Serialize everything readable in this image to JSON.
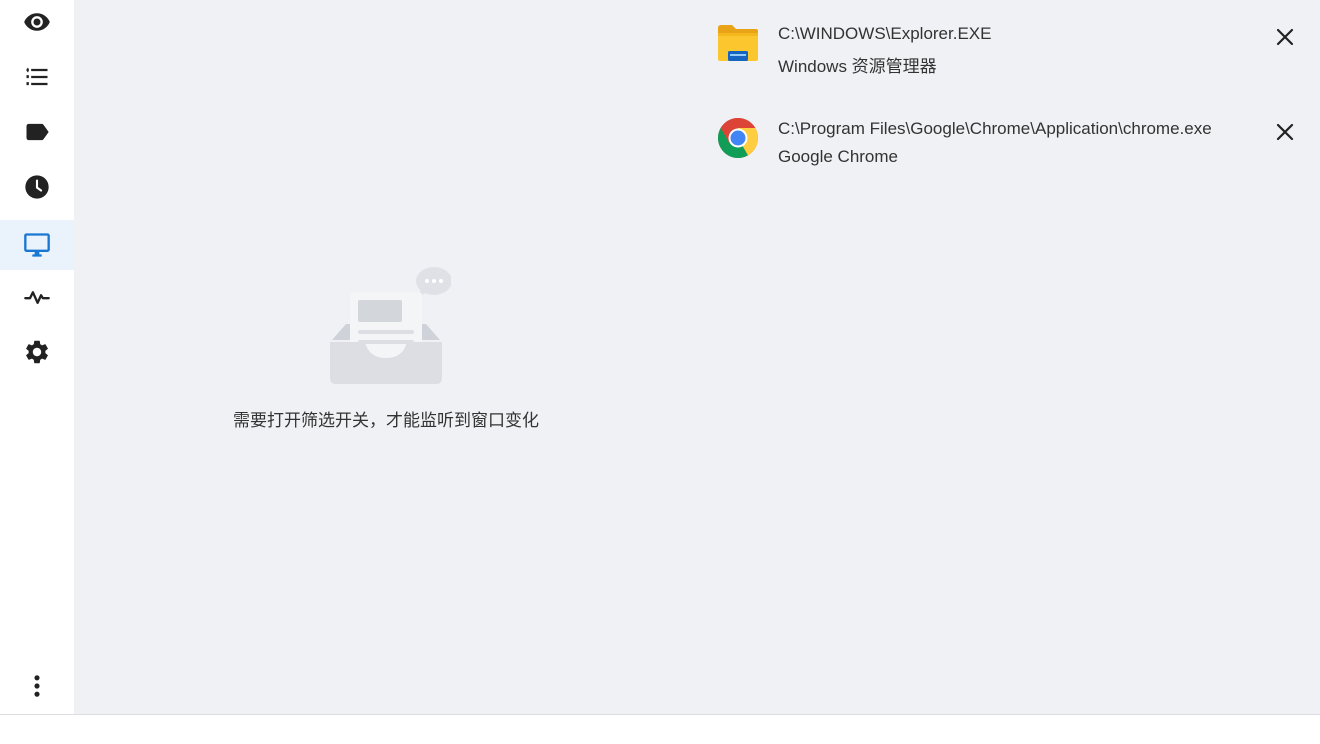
{
  "sidebar": {
    "items": [
      {
        "id": "eye",
        "icon": "eye-icon",
        "active": false
      },
      {
        "id": "list",
        "icon": "list-icon",
        "active": false
      },
      {
        "id": "tag",
        "icon": "label-icon",
        "active": false
      },
      {
        "id": "clock",
        "icon": "clock-icon",
        "active": false
      },
      {
        "id": "monitor",
        "icon": "monitor-icon",
        "active": true
      },
      {
        "id": "activity",
        "icon": "activity-icon",
        "active": false
      },
      {
        "id": "settings",
        "icon": "gear-icon",
        "active": false
      }
    ],
    "more_icon": "more-vertical-icon"
  },
  "main": {
    "empty_state": {
      "icon": "empty-inbox-icon",
      "text": "需要打开筛选开关，才能监听到窗口变化"
    },
    "processes": [
      {
        "path": "C:\\WINDOWS\\Explorer.EXE",
        "name": "Windows 资源管理器",
        "icon": "folder-icon"
      },
      {
        "path": "C:\\Program Files\\Google\\Chrome\\Application\\chrome.exe",
        "name": "Google Chrome",
        "icon": "chrome-icon"
      }
    ]
  },
  "colors": {
    "accent": "#1976d2",
    "active_bg": "#eaf3fb",
    "main_bg": "#f0f1f5",
    "icon_dark": "#222222"
  }
}
